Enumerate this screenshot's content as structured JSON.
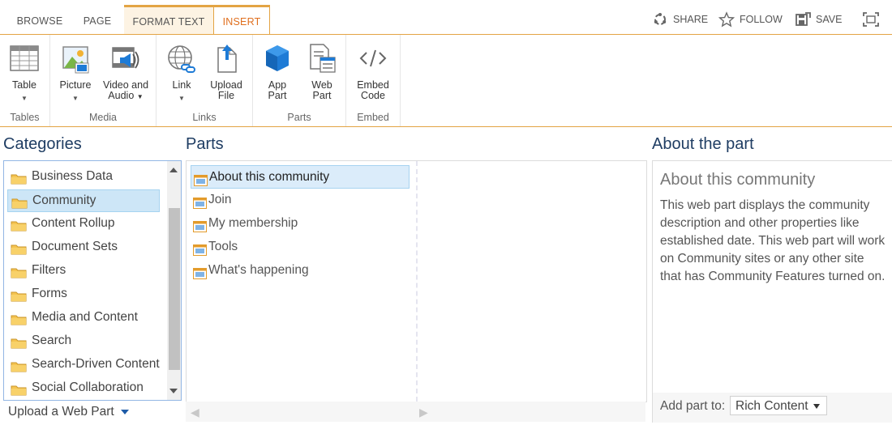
{
  "tabs": {
    "browse": "BROWSE",
    "page": "PAGE",
    "format_text": "FORMAT TEXT",
    "insert": "INSERT"
  },
  "actions": {
    "share": "SHARE",
    "follow": "FOLLOW",
    "save": "SAVE"
  },
  "ribbon": {
    "groups": {
      "tables": "Tables",
      "media": "Media",
      "links": "Links",
      "parts": "Parts",
      "embed": "Embed"
    },
    "buttons": {
      "table": "Table",
      "picture": "Picture",
      "video_audio_1": "Video and",
      "video_audio_2": "Audio",
      "link": "Link",
      "upload_1": "Upload",
      "upload_2": "File",
      "app_part_1": "App",
      "app_part_2": "Part",
      "web_part_1": "Web",
      "web_part_2": "Part",
      "embed_1": "Embed",
      "embed_2": "Code"
    }
  },
  "categories": {
    "title": "Categories",
    "items": [
      "Business Data",
      "Community",
      "Content Rollup",
      "Document Sets",
      "Filters",
      "Forms",
      "Media and Content",
      "Search",
      "Search-Driven Content",
      "Social Collaboration"
    ],
    "selected": "Community",
    "upload_label": "Upload a Web Part"
  },
  "parts": {
    "title": "Parts",
    "items": [
      "About this community",
      "Join",
      "My membership",
      "Tools",
      "What's happening"
    ],
    "selected": "About this community"
  },
  "about": {
    "title": "About the part",
    "name": "About this community",
    "description": "This web part displays the community description and other properties like established date. This web part will work on Community sites or any other site that has Community Features turned on.",
    "add_part_label": "Add part to:",
    "add_part_value": "Rich Content"
  },
  "colors": {
    "accent": "#e3a444",
    "active_tab_text": "#e06f1e",
    "title": "#1f3d63",
    "selection": "#cde6f7",
    "selection_border": "#a6d3f0",
    "app_part_blue": "#1e7bd6"
  },
  "icons": {
    "share": "share-icon",
    "follow": "star-icon",
    "save": "save-icon",
    "focus": "focus-mode-icon"
  }
}
